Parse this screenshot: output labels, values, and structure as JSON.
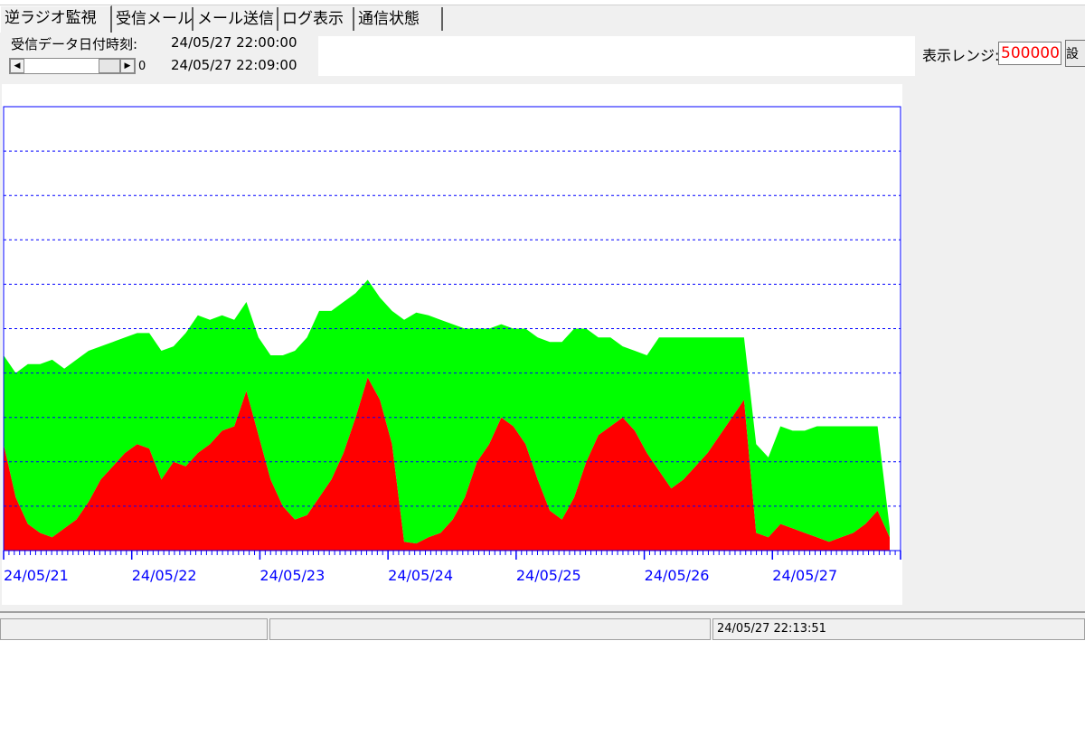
{
  "tabs": [
    {
      "label": "逆ラジオ監視",
      "active": true
    },
    {
      "label": "受信メール",
      "active": false
    },
    {
      "label": "メール送信",
      "active": false
    },
    {
      "label": "ログ表示",
      "active": false
    },
    {
      "label": "通信状態",
      "active": false
    }
  ],
  "info": {
    "received_label": "受信データ日付時刻:",
    "received_time_1": "24/05/27 22:00:00",
    "received_time_2": "24/05/27 22:09:00",
    "scroll_value": "0"
  },
  "range": {
    "label": "表示レンジ:",
    "value": "500000",
    "button_label": "設"
  },
  "status": {
    "timestamp": "24/05/27 22:13:51"
  },
  "colors": {
    "green": "#00ff00",
    "red": "#ff0000",
    "axis": "#0000ff",
    "input_text": "#ff0000"
  },
  "chart_data": {
    "type": "area",
    "stacked": true,
    "grid": true,
    "grid_style": "dashed horizontal",
    "x_tick_labels": [
      "24/05/21",
      "24/05/22",
      "24/05/23",
      "24/05/24",
      "24/05/25",
      "24/05/26",
      "24/05/27"
    ],
    "ylim": [
      0,
      500000
    ],
    "series": [
      {
        "color": "#ff0000",
        "values": [
          120000,
          60000,
          30000,
          20000,
          15000,
          25000,
          35000,
          55000,
          80000,
          95000,
          110000,
          120000,
          115000,
          80000,
          100000,
          95000,
          110000,
          120000,
          135000,
          140000,
          180000,
          130000,
          80000,
          50000,
          35000,
          40000,
          60000,
          80000,
          110000,
          150000,
          195000,
          170000,
          120000,
          10000,
          8000,
          15000,
          20000,
          35000,
          60000,
          100000,
          120000,
          150000,
          140000,
          120000,
          80000,
          45000,
          35000,
          60000,
          100000,
          130000,
          140000,
          150000,
          135000,
          110000,
          90000,
          70000,
          80000,
          95000,
          110000,
          130000,
          150000,
          170000,
          20000,
          15000,
          30000,
          25000,
          20000,
          15000,
          10000,
          15000,
          20000,
          30000,
          45000,
          15000
        ]
      },
      {
        "color": "#00ff00",
        "values": [
          100000,
          140000,
          180000,
          190000,
          200000,
          180000,
          180000,
          170000,
          150000,
          140000,
          130000,
          125000,
          130000,
          145000,
          130000,
          150000,
          155000,
          140000,
          130000,
          120000,
          100000,
          110000,
          140000,
          170000,
          190000,
          200000,
          210000,
          190000,
          170000,
          140000,
          110000,
          115000,
          150000,
          250000,
          260000,
          250000,
          240000,
          220000,
          190000,
          150000,
          130000,
          105000,
          110000,
          130000,
          160000,
          190000,
          200000,
          190000,
          150000,
          110000,
          100000,
          80000,
          90000,
          110000,
          150000,
          170000,
          160000,
          145000,
          130000,
          110000,
          90000,
          70000,
          100000,
          90000,
          110000,
          110000,
          115000,
          125000,
          130000,
          125000,
          120000,
          110000,
          95000,
          10000
        ]
      }
    ]
  }
}
